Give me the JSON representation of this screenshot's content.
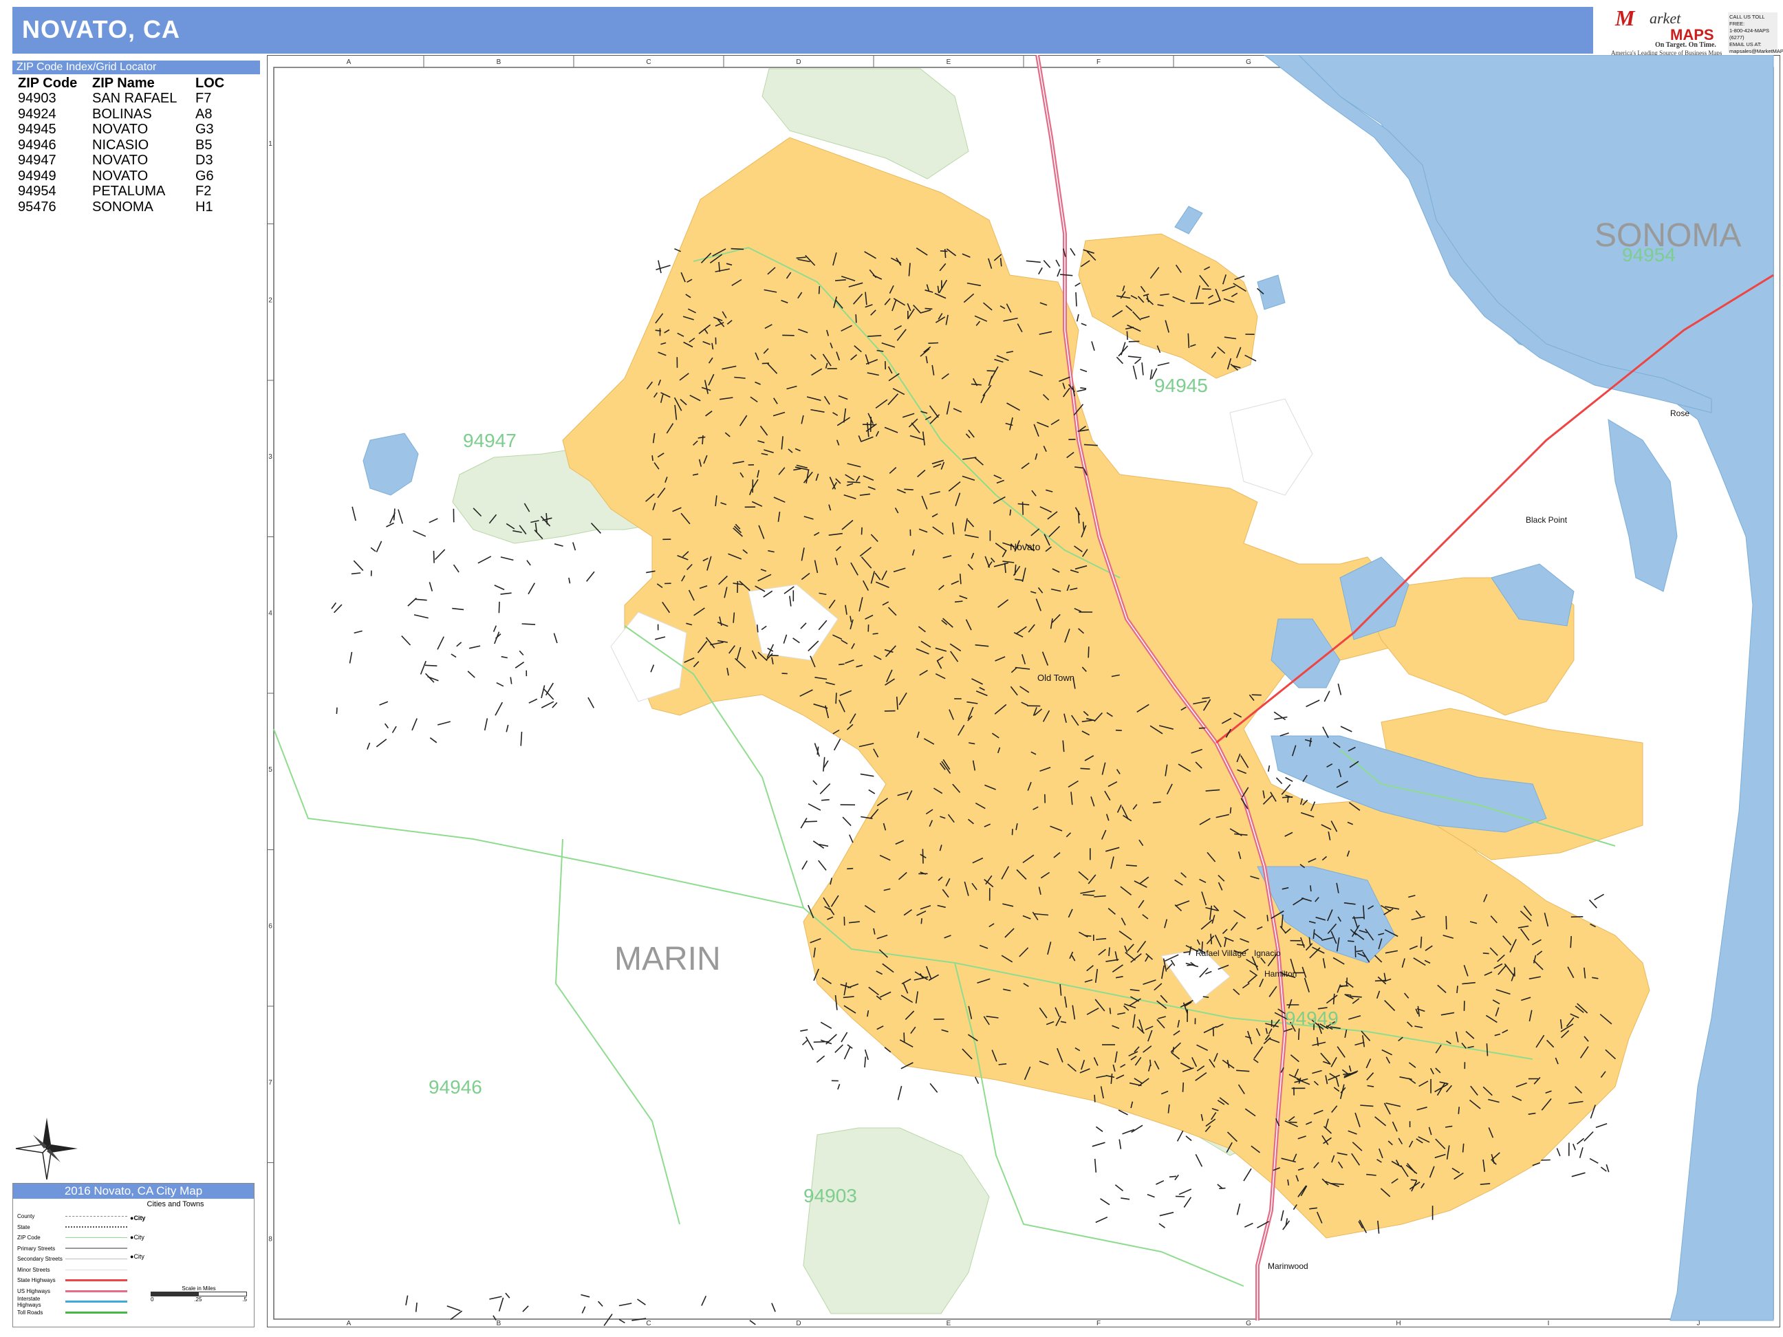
{
  "title": "NOVATO, CA",
  "logo": {
    "letter": "M",
    "word1": "arket",
    "word2": "MAPS",
    "tagline": "On Target. On Time.",
    "subtag": "America's Leading Source of Business Maps"
  },
  "contact": {
    "line1": "CALL US TOLL FREE:",
    "line2": "1-800-424-MAPS (6277)",
    "line3": "EMAIL US AT:",
    "line4": "mapsales@MarketMAPS.com"
  },
  "zip_index": {
    "header": "ZIP Code Index/Grid Locator",
    "columns": [
      "ZIP Code",
      "ZIP Name",
      "LOC"
    ],
    "rows": [
      [
        "94903",
        "SAN RAFAEL",
        "F7"
      ],
      [
        "94924",
        "BOLINAS",
        "A8"
      ],
      [
        "94945",
        "NOVATO",
        "G3"
      ],
      [
        "94946",
        "NICASIO",
        "B5"
      ],
      [
        "94947",
        "NOVATO",
        "D3"
      ],
      [
        "94949",
        "NOVATO",
        "G6"
      ],
      [
        "94954",
        "PETALUMA",
        "F2"
      ],
      [
        "95476",
        "SONOMA",
        "H1"
      ]
    ]
  },
  "grid": {
    "columns": [
      "A",
      "B",
      "C",
      "D",
      "E",
      "F",
      "G",
      "H",
      "I",
      "J"
    ],
    "rows": [
      "1",
      "2",
      "3",
      "4",
      "5",
      "6",
      "7",
      "8"
    ]
  },
  "map_labels": {
    "counties": [
      "SONOMA",
      "MARIN"
    ],
    "zip_labels": [
      "94954",
      "94945",
      "94947",
      "94949",
      "94946",
      "94903"
    ],
    "places": [
      "Novato",
      "Old Town",
      "Black Point",
      "Ignacio",
      "Hamilton",
      "Rafael Village",
      "Marinwood",
      "Rose"
    ]
  },
  "colors": {
    "title_bar": "#6f96da",
    "city_fill": "#fdd57e",
    "water": "#9dc3e6",
    "park": "#e3efda",
    "zip_boundary": "#8fdc8f",
    "highway": "#e56c88",
    "state_hwy": "#ee4444",
    "county_label": "#999999",
    "zip_label": "#7dce8e"
  },
  "legend": {
    "title": "2016 Novato, CA City Map",
    "items": [
      "County",
      "State",
      "ZIP Code",
      "Primary Streets",
      "Secondary Streets",
      "Minor Streets",
      "State Highways",
      "US Highways",
      "Interstate Highways",
      "Toll Roads"
    ],
    "cities_title": "Cities and Towns",
    "city_label": "City",
    "scale_label": "Scale in Miles",
    "scale_ticks": [
      "0",
      ".25",
      ".5"
    ]
  },
  "compass": {
    "icon": "compass-rose-icon",
    "north": "N"
  }
}
